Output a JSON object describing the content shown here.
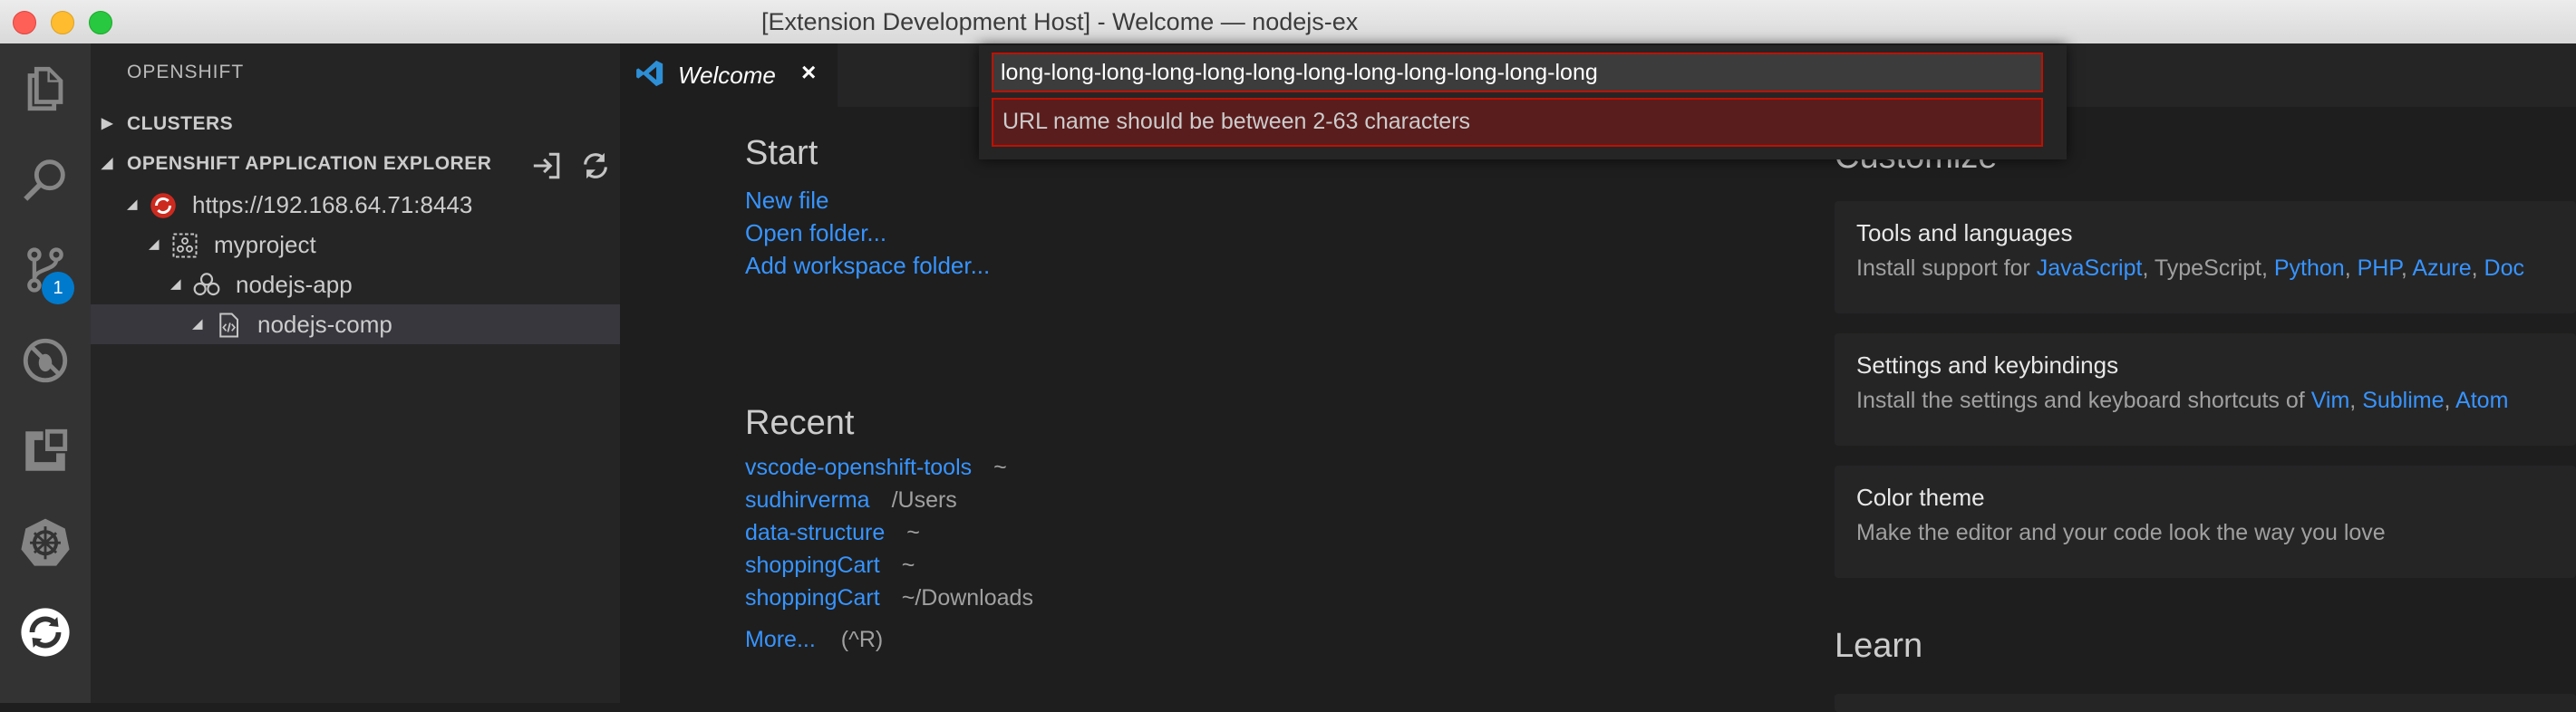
{
  "window": {
    "title": "[Extension Development Host] - Welcome — nodejs-ex"
  },
  "activity_bar": {
    "items": [
      "files-icon",
      "search-icon",
      "source-control-icon",
      "debug-icon",
      "extensions-icon",
      "kubernetes-icon",
      "openshift-icon"
    ],
    "scm_badge": "1"
  },
  "sidebar": {
    "title": "OPENSHIFT",
    "sections": {
      "clusters": "CLUSTERS",
      "explorer": "OPENSHIFT APPLICATION EXPLORER"
    },
    "tree": [
      {
        "label": "https://192.168.64.71:8443",
        "icon": "openshift-cluster-icon"
      },
      {
        "label": "myproject",
        "icon": "project-icon"
      },
      {
        "label": "nodejs-app",
        "icon": "application-icon"
      },
      {
        "label": "nodejs-comp",
        "icon": "component-icon"
      }
    ]
  },
  "tabs": [
    {
      "label": "Welcome",
      "close": "×"
    }
  ],
  "welcome": {
    "start_heading": "Start",
    "start_links": [
      "New file",
      "Open folder...",
      "Add workspace folder..."
    ],
    "recent_heading": "Recent",
    "recent": [
      {
        "name": "vscode-openshift-tools",
        "path": "~"
      },
      {
        "name": "sudhirverma",
        "path": "/Users"
      },
      {
        "name": "data-structure",
        "path": "~"
      },
      {
        "name": "shoppingCart",
        "path": "~"
      },
      {
        "name": "shoppingCart",
        "path": "~/Downloads"
      }
    ],
    "more": "More...",
    "more_shortcut": "(^R)",
    "customize_heading": "Customize",
    "cards": [
      {
        "title": "Tools and languages",
        "prefix": "Install support for ",
        "items": [
          {
            "text": "JavaScript",
            "link": true
          },
          {
            "text": ", TypeScript, ",
            "link": false
          },
          {
            "text": "Python",
            "link": true
          },
          {
            "text": ", ",
            "link": false
          },
          {
            "text": "PHP",
            "link": true
          },
          {
            "text": ", ",
            "link": false
          },
          {
            "text": "Azure",
            "link": true
          },
          {
            "text": ", ",
            "link": false
          },
          {
            "text": "Doc",
            "link": true
          }
        ]
      },
      {
        "title": "Settings and keybindings",
        "prefix": "Install the settings and keyboard shortcuts of ",
        "items": [
          {
            "text": "Vim",
            "link": true
          },
          {
            "text": ", ",
            "link": false
          },
          {
            "text": "Sublime",
            "link": true
          },
          {
            "text": ", ",
            "link": false
          },
          {
            "text": "Atom",
            "link": true
          }
        ]
      },
      {
        "title": "Color theme",
        "prefix": "Make the editor and your code look the way you love",
        "items": []
      }
    ],
    "learn_heading": "Learn"
  },
  "quick_input": {
    "value": "long-long-long-long-long-long-long-long-long-long-long-long",
    "validation_message": "URL name should be between 2-63 characters"
  },
  "colors": {
    "accent": "#007acc",
    "link": "#3794ff",
    "error_border": "#be1100",
    "error_bg": "#5a1d1d"
  }
}
